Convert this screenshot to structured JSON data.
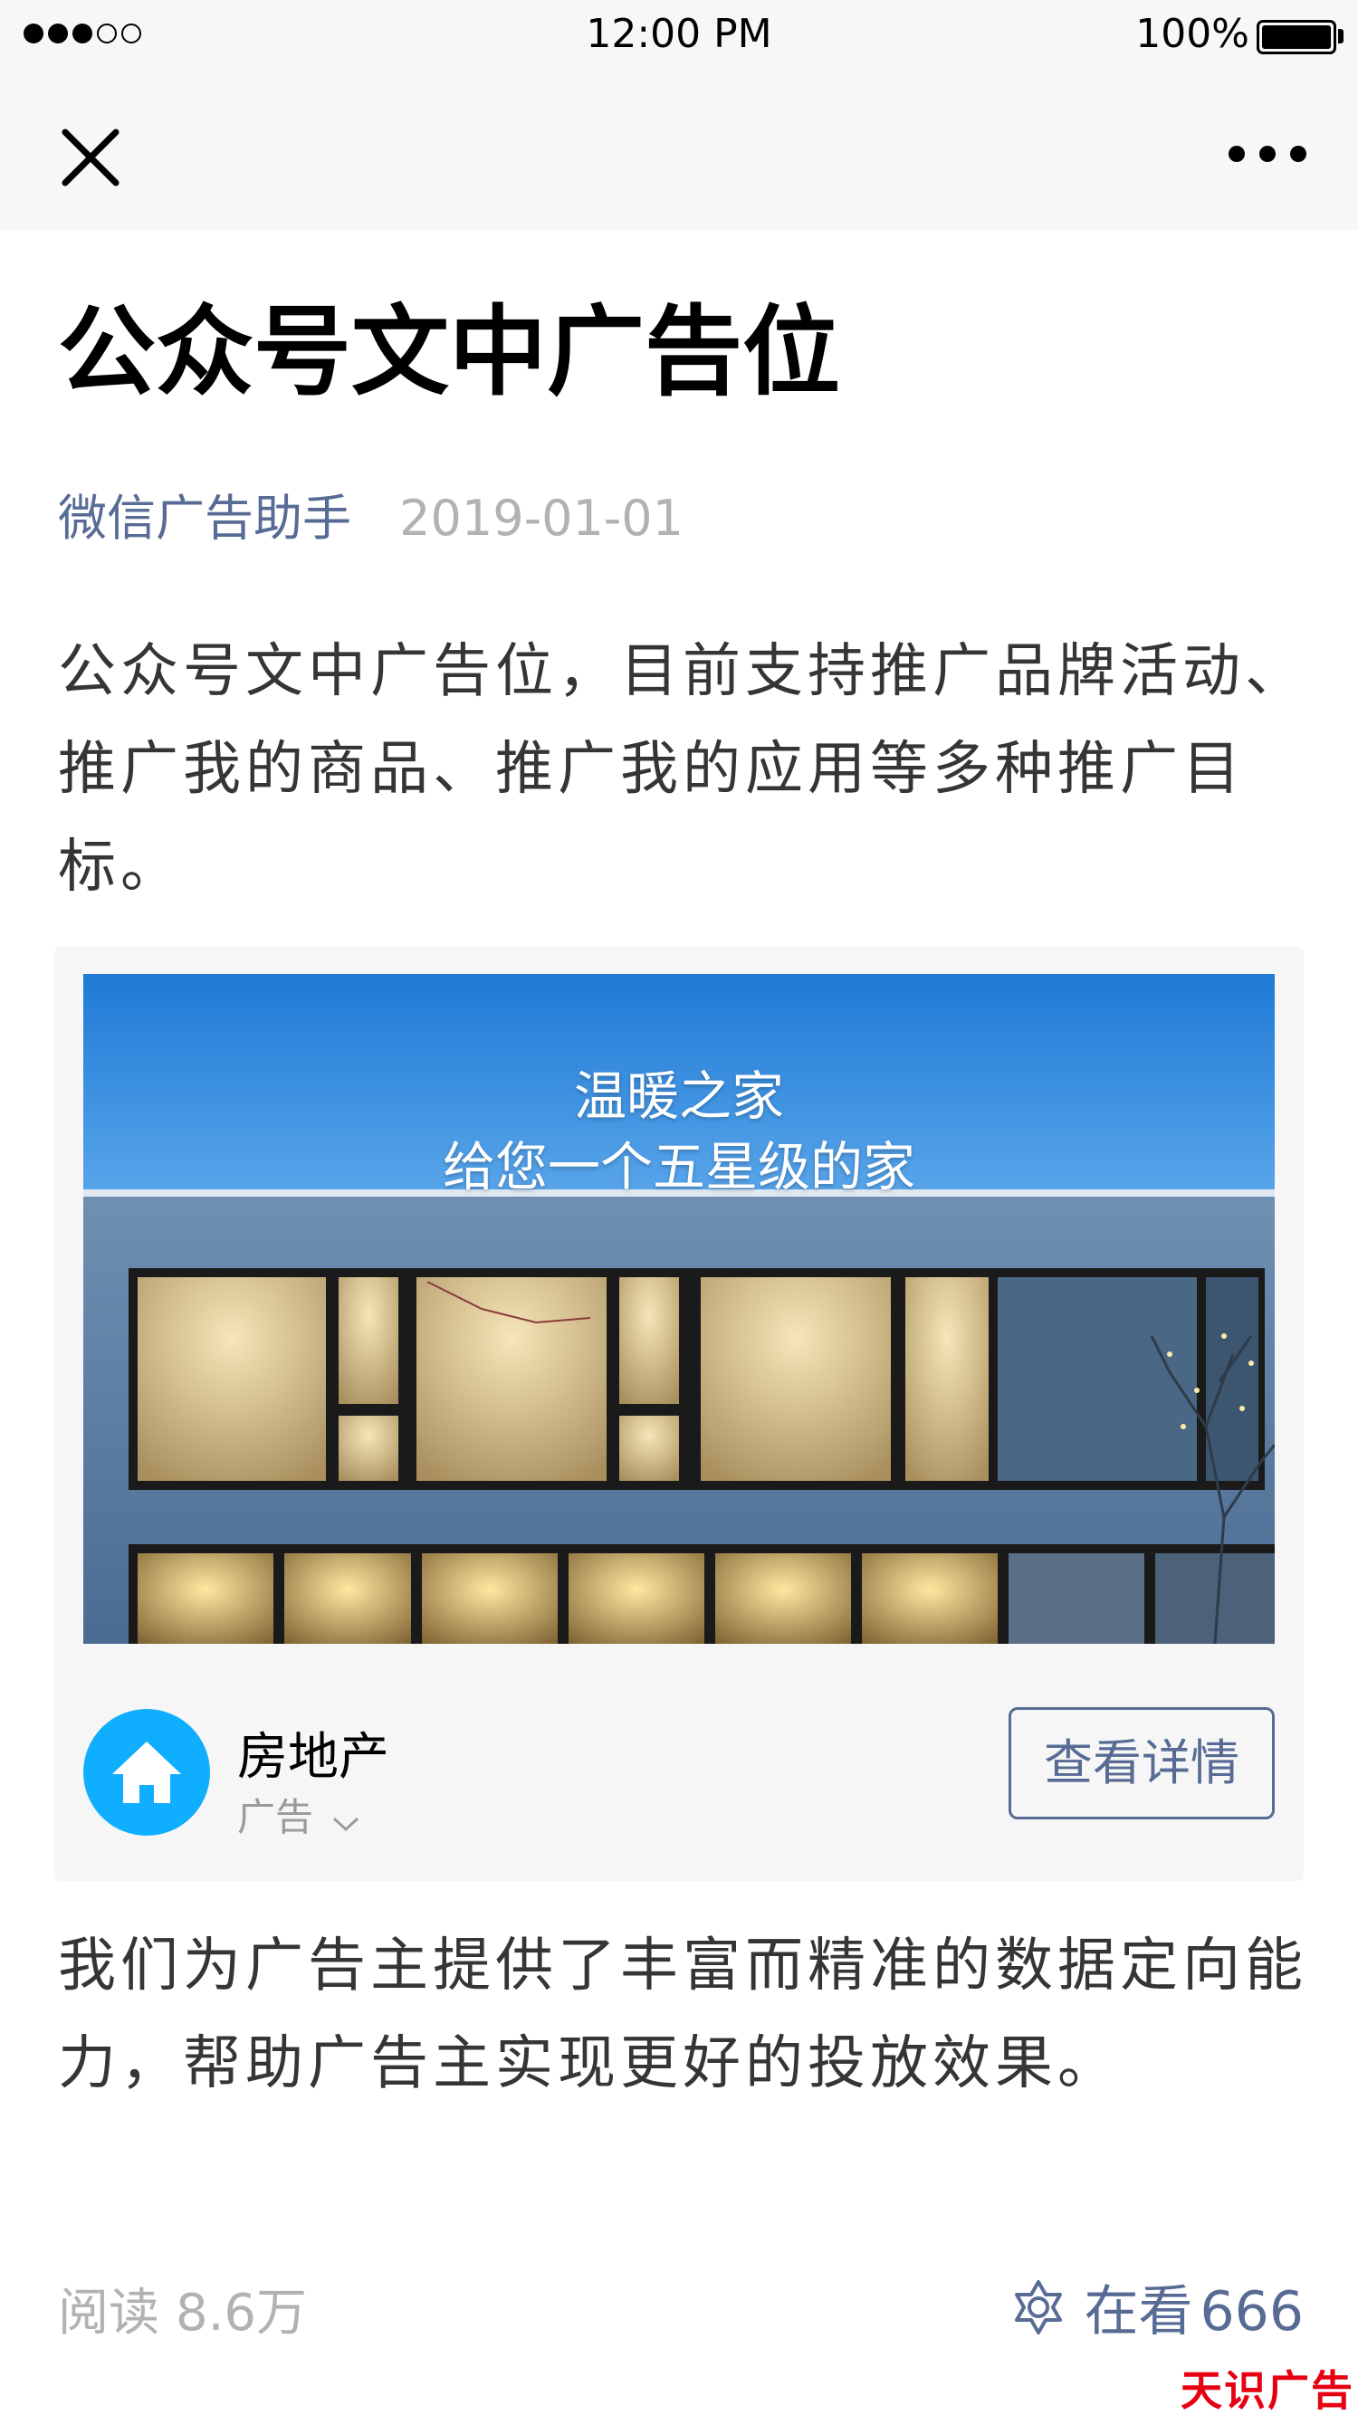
{
  "status_bar": {
    "time": "12:00 PM",
    "battery": "100%",
    "signal_dots_filled": 3,
    "signal_dots_total": 5
  },
  "nav": {
    "close_icon": "close-icon",
    "more_icon": "more-icon"
  },
  "article": {
    "title": "公众号文中广告位",
    "author": "微信广告助手",
    "date": "2019-01-01",
    "paragraph_1": "公众号文中广告位，目前支持推广品牌活动、推广我的商品、推广我的应用等多种推广目标。",
    "paragraph_2": "我们为广告主提供了丰富而精准的数据定向能力，帮助广告主实现更好的投放效果。"
  },
  "ad": {
    "headline_line1": "温暖之家",
    "headline_line2": "给您一个五星级的家",
    "brand_name": "房地产",
    "label": "广告",
    "cta": "查看详情",
    "avatar_icon": "house-icon",
    "avatar_color": "#10aeff"
  },
  "footer": {
    "reads_label": "阅读",
    "reads_count": "8.6万",
    "wow_label": "在看",
    "wow_count": "666",
    "wow_icon": "wow-star-icon"
  },
  "watermark": "天识广告",
  "colors": {
    "link": "#576b95",
    "muted": "#b2b2b2",
    "text": "#353535"
  }
}
